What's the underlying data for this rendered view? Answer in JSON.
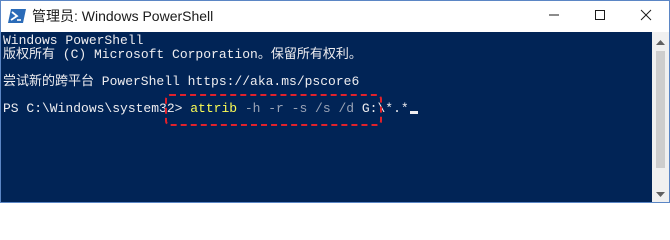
{
  "window": {
    "title": "管理员: Windows PowerShell",
    "icon": "powershell-icon",
    "controls": {
      "minimize": "minimize-icon",
      "maximize": "maximize-icon",
      "close": "close-icon"
    }
  },
  "console": {
    "background_color": "#012456",
    "lines": [
      "Windows PowerShell",
      "版权所有 (C) Microsoft Corporation。保留所有权利。",
      "尝试新的跨平台 PowerShell https://aka.ms/pscore6"
    ],
    "prompt": "PS C:\\Windows\\system32> ",
    "command": {
      "name": "attrib",
      "params": " -h -r -s /s /d ",
      "argument": "G:\\*.*"
    },
    "highlight_color": "#e0212b"
  }
}
